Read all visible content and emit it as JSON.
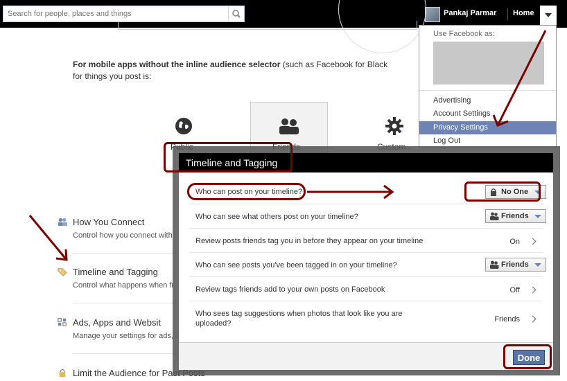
{
  "topbar": {
    "search_placeholder": "Search for people, places and things",
    "user_name": "Pankaj Parmar",
    "home_label": "Home"
  },
  "page": {
    "mobile_title": "For mobile apps without the inline audience selector",
    "mobile_rest": " (such as Facebook for Black",
    "mobile_line2": "for things you post is:",
    "audience_public": "Public",
    "audience_friends": "Friends",
    "audience_custom": "Custom",
    "sections": [
      {
        "title": "How You Connect",
        "desc": "Control how you connect with"
      },
      {
        "title": "Timeline and Tagging",
        "desc": "Control what happens when fr"
      },
      {
        "title": "Ads, Apps and Websit",
        "desc": "Manage your settings for ads,"
      },
      {
        "title": "Limit the Audience for Past Posts",
        "desc": ""
      }
    ]
  },
  "dropdown": {
    "use_as": "Use Facebook as:",
    "items": [
      "Advertising",
      "Account Settings",
      "Privacy Settings",
      "Log Out"
    ]
  },
  "dialog": {
    "title": "Timeline and Tagging",
    "rows": [
      {
        "label": "Who can post on your timeline?",
        "value": "No One"
      },
      {
        "label": "Who can see what others post on your timeline?",
        "value": "Friends"
      },
      {
        "label": "Review posts friends tag you in before they appear on your timeline",
        "value": "On"
      },
      {
        "label": "Who can see posts you've been tagged in on your timeline?",
        "value": "Friends"
      },
      {
        "label": "Review tags friends add to your own posts on Facebook",
        "value": "Off"
      },
      {
        "label_line1": "Who sees tag suggestions when photos that look like you are",
        "label_line2": "uploaded?",
        "value": "Friends"
      }
    ],
    "done_label": "Done"
  },
  "colors": {
    "topbar": "#000000",
    "accent": "#6d84b4",
    "annotation": "#7a0000",
    "done_button": "#5b74a8"
  },
  "icons": [
    "search-icon",
    "globe-icon",
    "friends-icon",
    "gear-icon",
    "lock-icon",
    "tag-icon",
    "people-icon",
    "ads-icon",
    "caret-down-icon",
    "chevron-right-icon"
  ]
}
